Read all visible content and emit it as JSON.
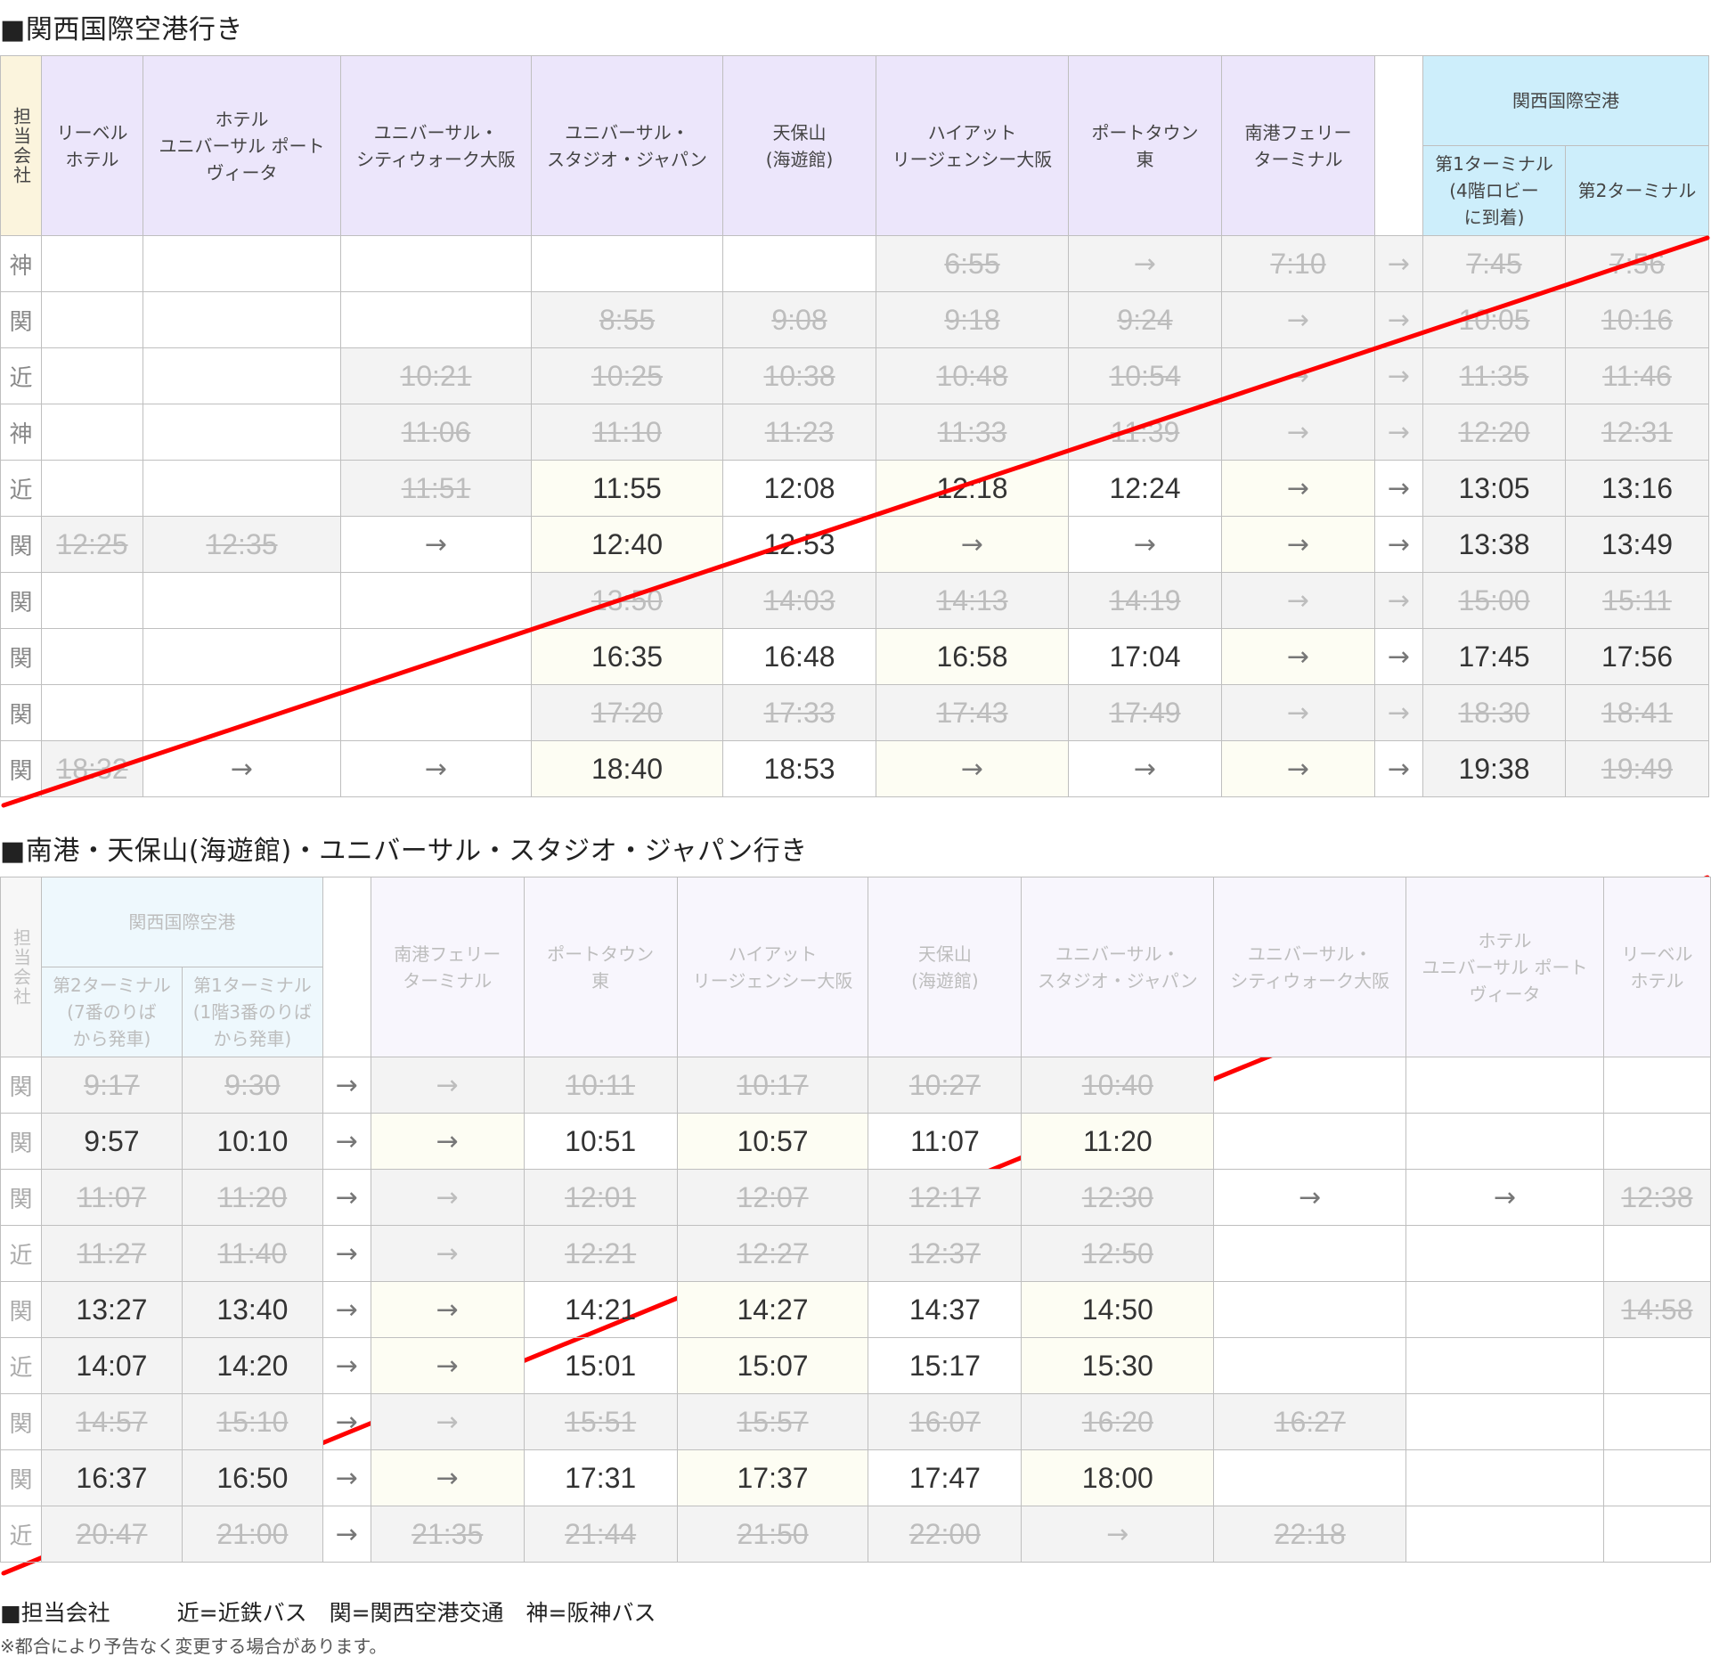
{
  "section1": {
    "title": "■関西国際空港行き",
    "company_header": "担当会社",
    "stops": [
      "リーベルホテル",
      "ホテルユニバーサル ポートヴィータ",
      "ユニバーサル・シティウォーク大阪",
      "ユニバーサル・スタジオ・ジャパン",
      "天保山(海遊館)",
      "ハイアットリージェンシー大阪",
      "ポートタウン東",
      "南港フェリーターミナル"
    ],
    "stops_display": [
      [
        "リーベル",
        "ホテル"
      ],
      [
        "ホテル",
        "ユニバーサル ポート",
        "ヴィータ"
      ],
      [
        "ユニバーサル・",
        "シティウォーク大阪"
      ],
      [
        "ユニバーサル・",
        "スタジオ・ジャパン"
      ],
      [
        "天保山",
        "(海遊館)"
      ],
      [
        "ハイアット",
        "リージェンシー大阪"
      ],
      [
        "ポートタウン",
        "東"
      ],
      [
        "南港フェリー",
        "ターミナル"
      ]
    ],
    "airport_header": "関西国際空港",
    "terminal_headers": [
      [
        "第1ターミナル",
        "(4階ロビー",
        "に到着)"
      ],
      [
        "第2ターミナル"
      ]
    ],
    "rows": [
      {
        "company": "神",
        "cells": [
          [
            "",
            ""
          ],
          [
            "",
            ""
          ],
          [
            "",
            ""
          ],
          [
            "",
            ""
          ],
          [
            "",
            ""
          ],
          [
            "6:55",
            "p"
          ],
          [
            "→",
            "pa"
          ],
          [
            "7:10",
            "p"
          ],
          [
            "→",
            "pa"
          ],
          [
            "7:45",
            "p"
          ],
          [
            "7:56",
            "p"
          ]
        ]
      },
      {
        "company": "関",
        "cells": [
          [
            "",
            ""
          ],
          [
            "",
            ""
          ],
          [
            "",
            ""
          ],
          [
            "8:55",
            "p"
          ],
          [
            "9:08",
            "p"
          ],
          [
            "9:18",
            "p"
          ],
          [
            "9:24",
            "p"
          ],
          [
            "→",
            "pa"
          ],
          [
            "→",
            "pa"
          ],
          [
            "10:05",
            "p"
          ],
          [
            "10:16",
            "p"
          ]
        ]
      },
      {
        "company": "近",
        "cells": [
          [
            "",
            ""
          ],
          [
            "",
            ""
          ],
          [
            "10:21",
            "p"
          ],
          [
            "10:25",
            "p"
          ],
          [
            "10:38",
            "p"
          ],
          [
            "10:48",
            "p"
          ],
          [
            "10:54",
            "p"
          ],
          [
            "→",
            "pa"
          ],
          [
            "→",
            "pa"
          ],
          [
            "11:35",
            "p"
          ],
          [
            "11:46",
            "p"
          ]
        ]
      },
      {
        "company": "神",
        "cells": [
          [
            "",
            ""
          ],
          [
            "",
            ""
          ],
          [
            "11:06",
            "p"
          ],
          [
            "11:10",
            "p"
          ],
          [
            "11:23",
            "p"
          ],
          [
            "11:33",
            "p"
          ],
          [
            "11:39",
            "p"
          ],
          [
            "→",
            "pa"
          ],
          [
            "→",
            "pa"
          ],
          [
            "12:20",
            "p"
          ],
          [
            "12:31",
            "p"
          ]
        ]
      },
      {
        "company": "近",
        "cells": [
          [
            "",
            ""
          ],
          [
            "",
            ""
          ],
          [
            "11:51",
            "p"
          ],
          [
            "11:55",
            "y"
          ],
          [
            "12:08",
            ""
          ],
          [
            "12:18",
            "y"
          ],
          [
            "12:24",
            ""
          ],
          [
            "→",
            "ya"
          ],
          [
            "→",
            "a"
          ],
          [
            "13:05",
            "g"
          ],
          [
            "13:16",
            "g"
          ]
        ]
      },
      {
        "company": "関",
        "cells": [
          [
            "12:25",
            "p"
          ],
          [
            "12:35",
            "p"
          ],
          [
            "→",
            "a"
          ],
          [
            "12:40",
            "y"
          ],
          [
            "12:53",
            ""
          ],
          [
            "→",
            "ya"
          ],
          [
            "→",
            "a"
          ],
          [
            "→",
            "ya"
          ],
          [
            "→",
            "a"
          ],
          [
            "13:38",
            "g"
          ],
          [
            "13:49",
            "g"
          ]
        ]
      },
      {
        "company": "関",
        "cells": [
          [
            "",
            ""
          ],
          [
            "",
            ""
          ],
          [
            "",
            ""
          ],
          [
            "13:50",
            "p"
          ],
          [
            "14:03",
            "p"
          ],
          [
            "14:13",
            "p"
          ],
          [
            "14:19",
            "p"
          ],
          [
            "→",
            "pa"
          ],
          [
            "→",
            "pa"
          ],
          [
            "15:00",
            "p"
          ],
          [
            "15:11",
            "p"
          ]
        ]
      },
      {
        "company": "関",
        "cells": [
          [
            "",
            ""
          ],
          [
            "",
            ""
          ],
          [
            "",
            ""
          ],
          [
            "16:35",
            "y"
          ],
          [
            "16:48",
            ""
          ],
          [
            "16:58",
            "y"
          ],
          [
            "17:04",
            ""
          ],
          [
            "→",
            "ya"
          ],
          [
            "→",
            "a"
          ],
          [
            "17:45",
            "g"
          ],
          [
            "17:56",
            "g"
          ]
        ]
      },
      {
        "company": "関",
        "cells": [
          [
            "",
            ""
          ],
          [
            "",
            ""
          ],
          [
            "",
            ""
          ],
          [
            "17:20",
            "p"
          ],
          [
            "17:33",
            "p"
          ],
          [
            "17:43",
            "p"
          ],
          [
            "17:49",
            "p"
          ],
          [
            "→",
            "pa"
          ],
          [
            "→",
            "pa"
          ],
          [
            "18:30",
            "p"
          ],
          [
            "18:41",
            "p"
          ]
        ]
      },
      {
        "company": "関",
        "cells": [
          [
            "18:32",
            "p"
          ],
          [
            "→",
            "a"
          ],
          [
            "→",
            "a"
          ],
          [
            "18:40",
            "y"
          ],
          [
            "18:53",
            ""
          ],
          [
            "→",
            "ya"
          ],
          [
            "→",
            "a"
          ],
          [
            "→",
            "ya"
          ],
          [
            "→",
            "a"
          ],
          [
            "19:38",
            "g"
          ],
          [
            "19:49",
            "p"
          ]
        ]
      }
    ]
  },
  "section2": {
    "title": "■南港・天保山(海遊館)・ユニバーサル・スタジオ・ジャパン行き",
    "company_header": "担当会社",
    "airport_header": "関西国際空港",
    "terminal_headers": [
      [
        "第2ターミナル",
        "(7番のりば",
        "から発車)"
      ],
      [
        "第1ターミナル",
        "(1階3番のりば",
        "から発車)"
      ]
    ],
    "stops": [
      "南港フェリーターミナル",
      "ポートタウン東",
      "ハイアットリージェンシー大阪",
      "天保山(海遊館)",
      "ユニバーサル・スタジオ・ジャパン",
      "ユニバーサル・シティウォーク大阪",
      "ホテルユニバーサル ポートヴィータ",
      "リーベルホテル"
    ],
    "stops_display": [
      [
        "南港フェリー",
        "ターミナル"
      ],
      [
        "ポートタウン",
        "東"
      ],
      [
        "ハイアット",
        "リージェンシー大阪"
      ],
      [
        "天保山",
        "(海遊館)"
      ],
      [
        "ユニバーサル・",
        "スタジオ・ジャパン"
      ],
      [
        "ユニバーサル・",
        "シティウォーク大阪"
      ],
      [
        "ホテル",
        "ユニバーサル ポート",
        "ヴィータ"
      ],
      [
        "リーベル",
        "ホテル"
      ]
    ],
    "rows": [
      {
        "company": "関",
        "cells": [
          [
            "9:17",
            "p"
          ],
          [
            "9:30",
            "p"
          ],
          [
            "→",
            "a"
          ],
          [
            "→",
            "pa"
          ],
          [
            "10:11",
            "p"
          ],
          [
            "10:17",
            "p"
          ],
          [
            "10:27",
            "p"
          ],
          [
            "10:40",
            "p"
          ],
          [
            "",
            ""
          ],
          [
            "",
            ""
          ],
          [
            "",
            ""
          ]
        ]
      },
      {
        "company": "関",
        "cells": [
          [
            "9:57",
            "g"
          ],
          [
            "10:10",
            "g"
          ],
          [
            "→",
            "a"
          ],
          [
            "→",
            "ya"
          ],
          [
            "10:51",
            ""
          ],
          [
            "10:57",
            "y"
          ],
          [
            "11:07",
            ""
          ],
          [
            "11:20",
            "y"
          ],
          [
            "",
            ""
          ],
          [
            "",
            ""
          ],
          [
            "",
            ""
          ]
        ]
      },
      {
        "company": "関",
        "cells": [
          [
            "11:07",
            "p"
          ],
          [
            "11:20",
            "p"
          ],
          [
            "→",
            "a"
          ],
          [
            "→",
            "pa"
          ],
          [
            "12:01",
            "p"
          ],
          [
            "12:07",
            "p"
          ],
          [
            "12:17",
            "p"
          ],
          [
            "12:30",
            "p"
          ],
          [
            "→",
            "a"
          ],
          [
            "→",
            "a"
          ],
          [
            "12:38",
            "p"
          ]
        ]
      },
      {
        "company": "近",
        "cells": [
          [
            "11:27",
            "p"
          ],
          [
            "11:40",
            "p"
          ],
          [
            "→",
            "a"
          ],
          [
            "→",
            "pa"
          ],
          [
            "12:21",
            "p"
          ],
          [
            "12:27",
            "p"
          ],
          [
            "12:37",
            "p"
          ],
          [
            "12:50",
            "p"
          ],
          [
            "",
            ""
          ],
          [
            "",
            ""
          ],
          [
            "",
            ""
          ]
        ]
      },
      {
        "company": "関",
        "cells": [
          [
            "13:27",
            "g"
          ],
          [
            "13:40",
            "g"
          ],
          [
            "→",
            "a"
          ],
          [
            "→",
            "ya"
          ],
          [
            "14:21",
            ""
          ],
          [
            "14:27",
            "y"
          ],
          [
            "14:37",
            ""
          ],
          [
            "14:50",
            "y"
          ],
          [
            "",
            ""
          ],
          [
            "",
            ""
          ],
          [
            "14:58",
            "p"
          ]
        ]
      },
      {
        "company": "近",
        "cells": [
          [
            "14:07",
            "g"
          ],
          [
            "14:20",
            "g"
          ],
          [
            "→",
            "a"
          ],
          [
            "→",
            "ya"
          ],
          [
            "15:01",
            ""
          ],
          [
            "15:07",
            "y"
          ],
          [
            "15:17",
            ""
          ],
          [
            "15:30",
            "y"
          ],
          [
            "",
            ""
          ],
          [
            "",
            ""
          ],
          [
            "",
            ""
          ]
        ]
      },
      {
        "company": "関",
        "cells": [
          [
            "14:57",
            "p"
          ],
          [
            "15:10",
            "p"
          ],
          [
            "→",
            "a"
          ],
          [
            "→",
            "pa"
          ],
          [
            "15:51",
            "p"
          ],
          [
            "15:57",
            "p"
          ],
          [
            "16:07",
            "p"
          ],
          [
            "16:20",
            "p"
          ],
          [
            "16:27",
            "p"
          ],
          [
            "",
            ""
          ],
          [
            "",
            ""
          ]
        ]
      },
      {
        "company": "関",
        "cells": [
          [
            "16:37",
            "g"
          ],
          [
            "16:50",
            "g"
          ],
          [
            "→",
            "a"
          ],
          [
            "→",
            "ya"
          ],
          [
            "17:31",
            ""
          ],
          [
            "17:37",
            "y"
          ],
          [
            "17:47",
            ""
          ],
          [
            "18:00",
            "y"
          ],
          [
            "",
            ""
          ],
          [
            "",
            ""
          ],
          [
            "",
            ""
          ]
        ]
      },
      {
        "company": "近",
        "cells": [
          [
            "20:47",
            "p"
          ],
          [
            "21:00",
            "p"
          ],
          [
            "→",
            "a"
          ],
          [
            "21:35",
            "p"
          ],
          [
            "21:44",
            "p"
          ],
          [
            "21:50",
            "p"
          ],
          [
            "22:00",
            "p"
          ],
          [
            "→",
            "pa"
          ],
          [
            "22:18",
            "p"
          ],
          [
            "",
            ""
          ],
          [
            "",
            ""
          ]
        ]
      }
    ]
  },
  "legend": {
    "label": "■担当会社",
    "items": "近=近鉄バス　関=関西空港交通　神=阪神バス"
  },
  "note": "※都合により予告なく変更する場合があります。",
  "colors": {
    "diagonal": "#ff0000",
    "stop_header": "#ece6fb",
    "airport_header": "#cdeefb",
    "company_header": "#fbf4dd"
  }
}
